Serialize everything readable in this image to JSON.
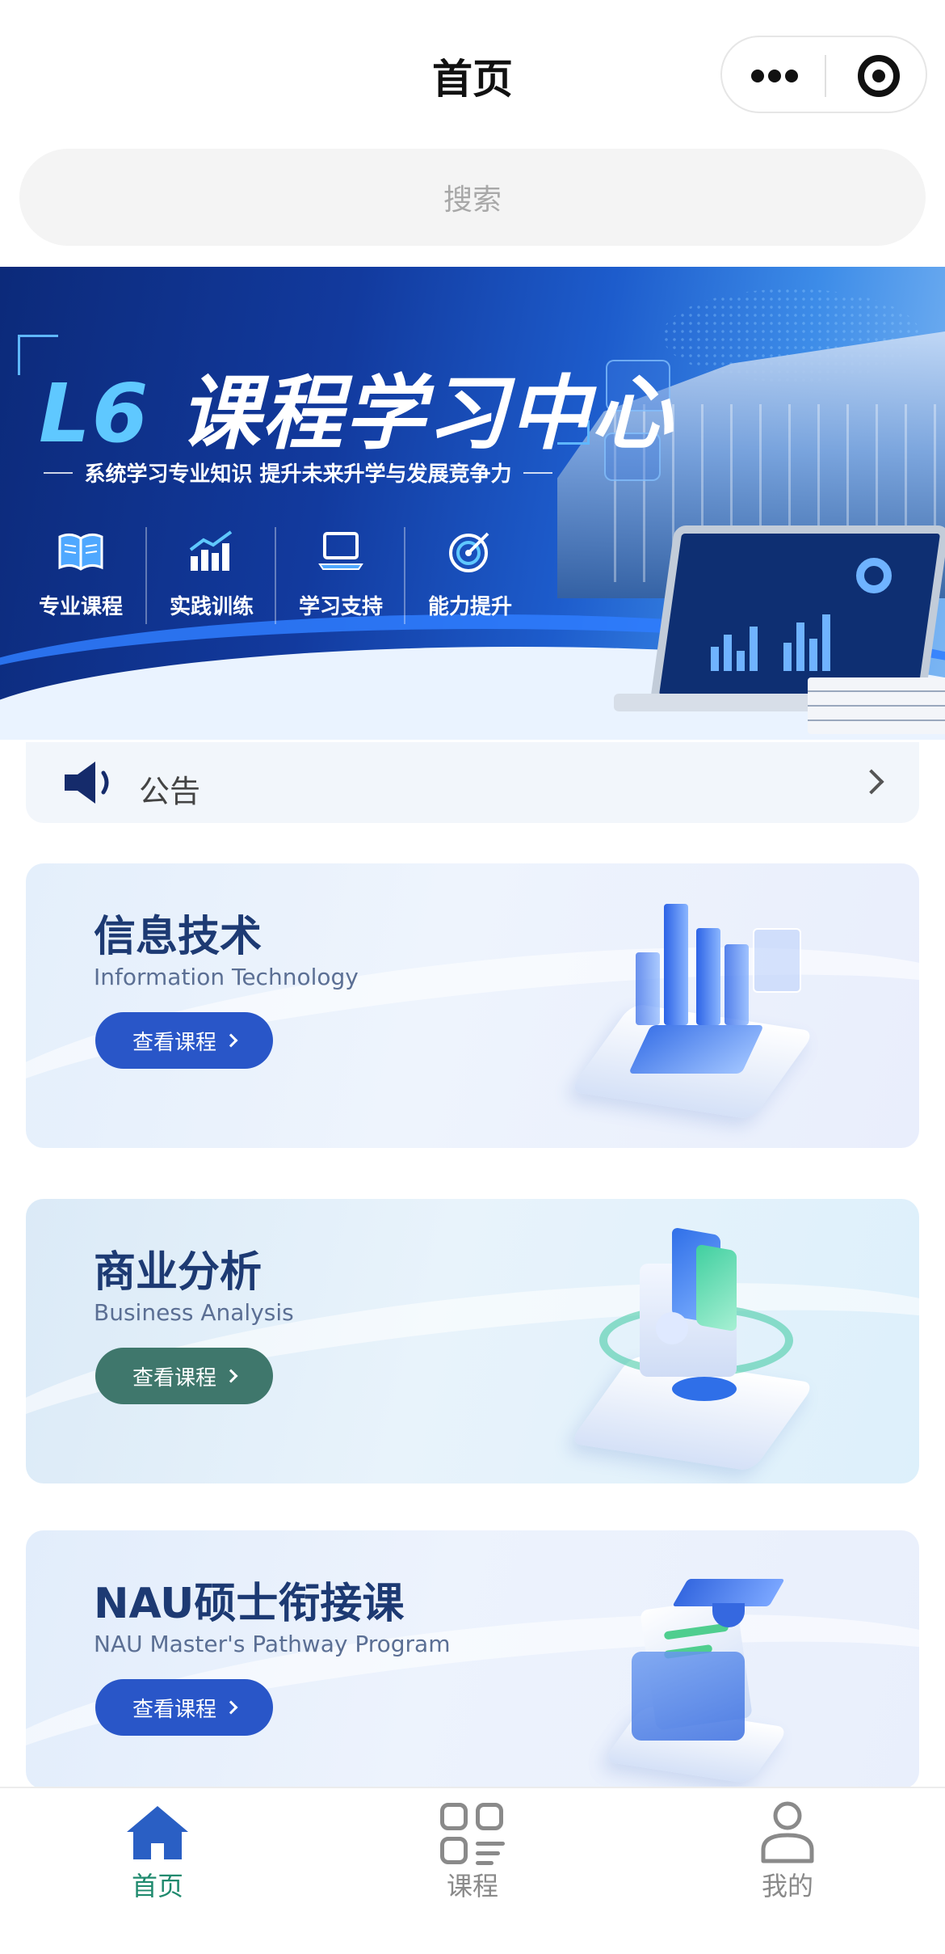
{
  "navbar": {
    "title": "首页"
  },
  "search": {
    "placeholder": "搜索"
  },
  "banner": {
    "title_highlight": "L6",
    "title_rest": "课程学习中心",
    "subtitle": "系统学习专业知识 提升未来升学与发展竞争力",
    "features": [
      {
        "label": "专业课程",
        "icon": "book-icon"
      },
      {
        "label": "实践训练",
        "icon": "bar-chart-icon"
      },
      {
        "label": "学习支持",
        "icon": "laptop-icon"
      },
      {
        "label": "能力提升",
        "icon": "target-icon"
      }
    ]
  },
  "notice": {
    "label": "公告"
  },
  "courses": [
    {
      "title": "信息技术",
      "subtitle": "Information Technology",
      "button": "查看课程",
      "color": "#2956c8"
    },
    {
      "title": "商业分析",
      "subtitle": "Business Analysis",
      "button": "查看课程",
      "color": "#3f776c"
    },
    {
      "title": "NAU硕士衔接课",
      "subtitle": "NAU Master's Pathway Program",
      "button": "查看课程",
      "color": "#2956c8"
    }
  ],
  "tabbar": {
    "items": [
      {
        "label": "首页",
        "icon": "home-icon",
        "active": true
      },
      {
        "label": "课程",
        "icon": "grid-icon",
        "active": false
      },
      {
        "label": "我的",
        "icon": "user-icon",
        "active": false
      }
    ],
    "active_color": "#1f8a6e"
  }
}
